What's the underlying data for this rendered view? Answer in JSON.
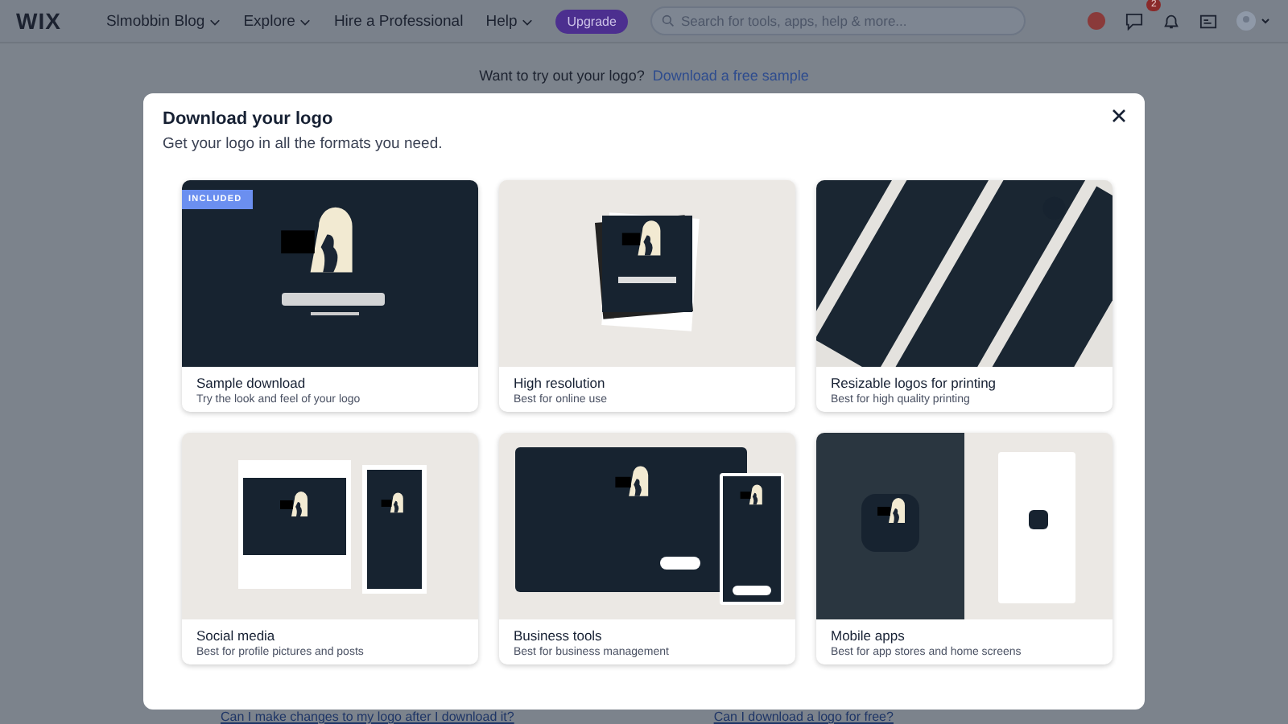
{
  "topbar": {
    "logo": "WIX",
    "site": "Slmobbin Blog",
    "nav": [
      {
        "label": "Explore",
        "dropdown": true
      },
      {
        "label": "Hire a Professional",
        "dropdown": false
      },
      {
        "label": "Help",
        "dropdown": true
      }
    ],
    "upgrade": "Upgrade",
    "search": {
      "placeholder": "Search for tools, apps, help & more..."
    },
    "notifications": "2"
  },
  "banner": {
    "text": "Want to try out your logo?",
    "link": "Download a free sample"
  },
  "dialog": {
    "title": "Download your logo",
    "subtitle": "Get your logo in all the formats you need.",
    "cards": [
      {
        "kind": "sample",
        "title": "Sample download",
        "description": "Try the look and feel of your logo",
        "badge": "INCLUDED"
      },
      {
        "kind": "hires",
        "title": "High resolution",
        "description": "Best for online use"
      },
      {
        "kind": "print",
        "title": "Resizable logos for printing",
        "description": "Best for high quality printing"
      },
      {
        "kind": "social",
        "title": "Social media",
        "description": "Best for profile pictures and posts"
      },
      {
        "kind": "business",
        "title": "Business tools",
        "description": "Best for business management"
      },
      {
        "kind": "mobile",
        "title": "Mobile apps",
        "description": "Best for app stores and home screens"
      }
    ]
  },
  "faq": [
    "Can I make changes to my logo after I download it?",
    "Can I download a logo for free?"
  ]
}
